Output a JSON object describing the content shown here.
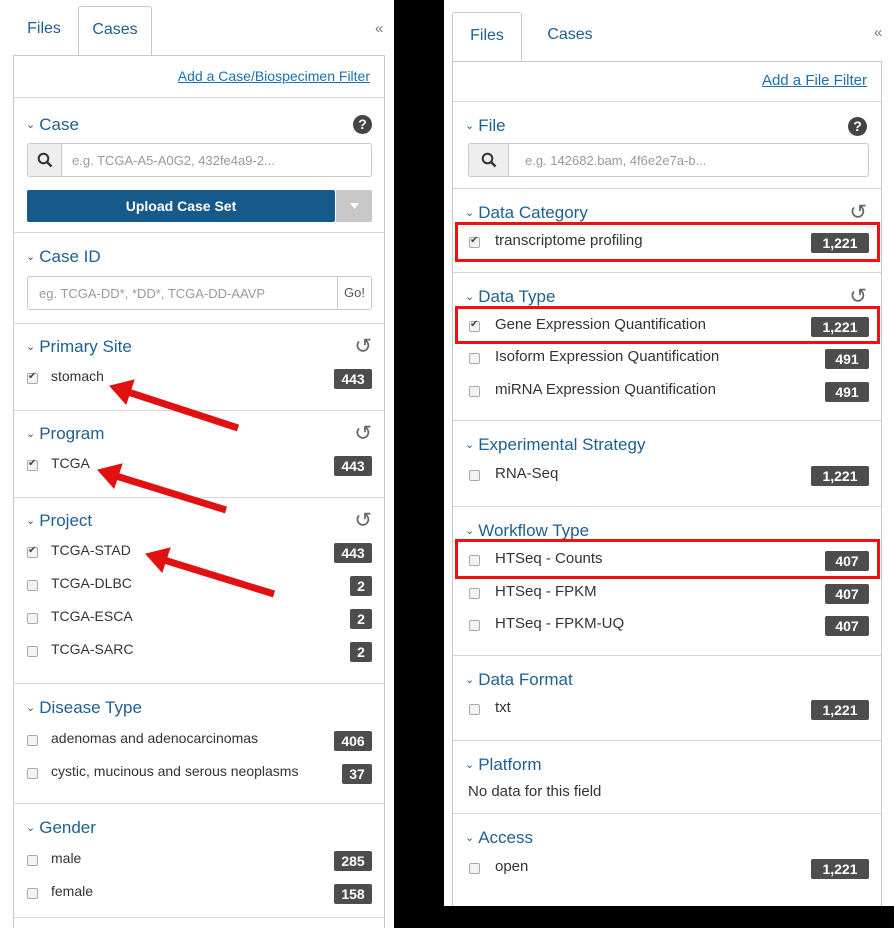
{
  "left_panel": {
    "tabs": [
      {
        "label": "Files",
        "active": false
      },
      {
        "label": "Cases",
        "active": true
      }
    ],
    "collapse_icon": "double-chevron-left-icon",
    "add_filter": "Add a Case/Biospecimen Filter",
    "case": {
      "title": "Case",
      "search_placeholder": "e.g. TCGA-A5-A0G2, 432fe4a9-2...",
      "upload_label": "Upload Case Set"
    },
    "case_id": {
      "title": "Case ID",
      "placeholder": "eg. TCGA-DD*, *DD*, TCGA-DD-AAVP",
      "go_label": "Go!"
    },
    "primary_site": {
      "title": "Primary Site",
      "items": [
        {
          "label": "stomach",
          "count": "443",
          "checked": true
        }
      ]
    },
    "program": {
      "title": "Program",
      "items": [
        {
          "label": "TCGA",
          "count": "443",
          "checked": true
        }
      ]
    },
    "project": {
      "title": "Project",
      "items": [
        {
          "label": "TCGA-STAD",
          "count": "443",
          "checked": true
        },
        {
          "label": "TCGA-DLBC",
          "count": "2",
          "checked": false
        },
        {
          "label": "TCGA-ESCA",
          "count": "2",
          "checked": false
        },
        {
          "label": "TCGA-SARC",
          "count": "2",
          "checked": false
        }
      ]
    },
    "disease_type": {
      "title": "Disease Type",
      "items": [
        {
          "label": "adenomas and adenocarcinomas",
          "count": "406",
          "checked": false
        },
        {
          "label": "cystic, mucinous and serous neoplasms",
          "count": "37",
          "checked": false
        }
      ]
    },
    "gender": {
      "title": "Gender",
      "items": [
        {
          "label": "male",
          "count": "285",
          "checked": false
        },
        {
          "label": "female",
          "count": "158",
          "checked": false
        }
      ]
    }
  },
  "right_panel": {
    "tabs": [
      {
        "label": "Files",
        "active": true
      },
      {
        "label": "Cases",
        "active": false
      }
    ],
    "collapse_icon": "double-chevron-left-icon",
    "add_filter": "Add a File Filter",
    "file": {
      "title": "File",
      "search_placeholder": "e.g. 142682.bam, 4f6e2e7a-b..."
    },
    "data_category": {
      "title": "Data Category",
      "items": [
        {
          "label": "transcriptome profiling",
          "count": "1,221",
          "checked": true
        }
      ]
    },
    "data_type": {
      "title": "Data Type",
      "items": [
        {
          "label": "Gene Expression Quantification",
          "count": "1,221",
          "checked": true
        },
        {
          "label": "Isoform Expression Quantification",
          "count": "491",
          "checked": false
        },
        {
          "label": "miRNA Expression Quantification",
          "count": "491",
          "checked": false
        }
      ]
    },
    "experimental_strategy": {
      "title": "Experimental Strategy",
      "items": [
        {
          "label": "RNA-Seq",
          "count": "1,221",
          "checked": false
        }
      ]
    },
    "workflow_type": {
      "title": "Workflow Type",
      "items": [
        {
          "label": "HTSeq - Counts",
          "count": "407",
          "checked": false
        },
        {
          "label": "HTSeq - FPKM",
          "count": "407",
          "checked": false
        },
        {
          "label": "HTSeq - FPKM-UQ",
          "count": "407",
          "checked": false
        }
      ]
    },
    "data_format": {
      "title": "Data Format",
      "items": [
        {
          "label": "txt",
          "count": "1,221",
          "checked": false
        }
      ]
    },
    "platform": {
      "title": "Platform",
      "empty_text": "No data for this field"
    },
    "access": {
      "title": "Access",
      "items": [
        {
          "label": "open",
          "count": "1,221",
          "checked": false
        }
      ]
    }
  },
  "annotation_colors": {
    "highlight": "#e11111",
    "arrow": "#e11111"
  }
}
